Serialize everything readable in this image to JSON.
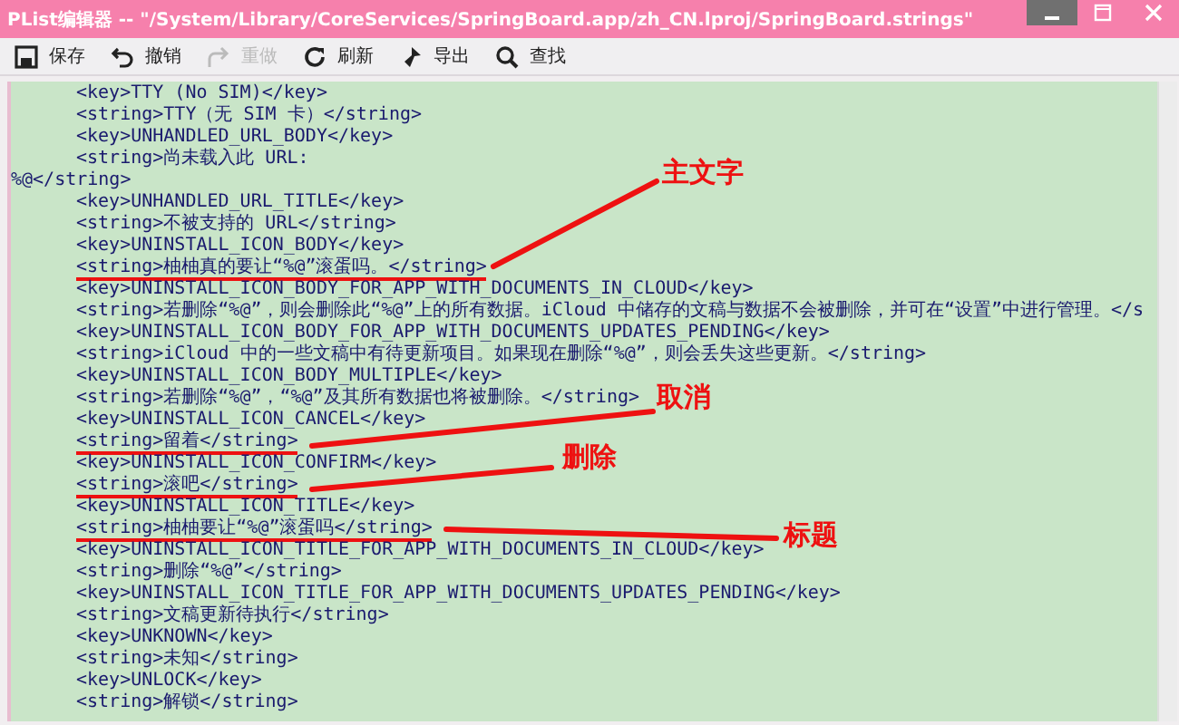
{
  "window": {
    "title": "PList编辑器 -- \"/System/Library/CoreServices/SpringBoard.app/zh_CN.lproj/SpringBoard.strings\""
  },
  "toolbar": [
    {
      "kind": "save",
      "label": "保存",
      "disabled": false
    },
    {
      "kind": "undo",
      "label": "撤销",
      "disabled": false
    },
    {
      "kind": "redo",
      "label": "重做",
      "disabled": true
    },
    {
      "kind": "refresh",
      "label": "刷新",
      "disabled": false
    },
    {
      "kind": "export",
      "label": "导出",
      "disabled": false
    },
    {
      "kind": "find",
      "label": "查找",
      "disabled": false
    }
  ],
  "editor": {
    "lines": [
      {
        "text": "<key>TTY (No SIM)</key>",
        "indent": true,
        "underlined": false
      },
      {
        "text": "<string>TTY（无 SIM 卡）</string>",
        "indent": true,
        "underlined": false
      },
      {
        "text": "<key>UNHANDLED_URL_BODY</key>",
        "indent": true,
        "underlined": false
      },
      {
        "text": "<string>尚未载入此 URL:",
        "indent": true,
        "underlined": false
      },
      {
        "text": "%@</string>",
        "indent": false,
        "underlined": false
      },
      {
        "text": "<key>UNHANDLED_URL_TITLE</key>",
        "indent": true,
        "underlined": false
      },
      {
        "text": "<string>不被支持的 URL</string>",
        "indent": true,
        "underlined": false
      },
      {
        "text": "<key>UNINSTALL_ICON_BODY</key>",
        "indent": true,
        "underlined": false
      },
      {
        "text": "<string>柚柚真的要让“%@”滚蛋吗。</string>",
        "indent": true,
        "underlined": true
      },
      {
        "text": "<key>UNINSTALL_ICON_BODY_FOR_APP_WITH_DOCUMENTS_IN_CLOUD</key>",
        "indent": true,
        "underlined": false
      },
      {
        "text": "<string>若删除“%@”，则会删除此“%@”上的所有数据。iCloud 中储存的文稿与数据不会被删除，并可在“设置”中进行管理。</s",
        "indent": true,
        "underlined": false
      },
      {
        "text": "<key>UNINSTALL_ICON_BODY_FOR_APP_WITH_DOCUMENTS_UPDATES_PENDING</key>",
        "indent": true,
        "underlined": false
      },
      {
        "text": "<string>iCloud 中的一些文稿中有待更新项目。如果现在删除“%@”，则会丢失这些更新。</string>",
        "indent": true,
        "underlined": false
      },
      {
        "text": "<key>UNINSTALL_ICON_BODY_MULTIPLE</key>",
        "indent": true,
        "underlined": false
      },
      {
        "text": "<string>若删除“%@”，“%@”及其所有数据也将被删除。</string>",
        "indent": true,
        "underlined": false
      },
      {
        "text": "<key>UNINSTALL_ICON_CANCEL</key>",
        "indent": true,
        "underlined": false
      },
      {
        "text": "<string>留着</string>",
        "indent": true,
        "underlined": true
      },
      {
        "text": "<key>UNINSTALL_ICON_CONFIRM</key>",
        "indent": true,
        "underlined": false
      },
      {
        "text": "<string>滚吧</string>",
        "indent": true,
        "underlined": true
      },
      {
        "text": "<key>UNINSTALL_ICON_TITLE</key>",
        "indent": true,
        "underlined": false
      },
      {
        "text": "<string>柚柚要让“%@”滚蛋吗</string>",
        "indent": true,
        "underlined": true
      },
      {
        "text": "<key>UNINSTALL_ICON_TITLE_FOR_APP_WITH_DOCUMENTS_IN_CLOUD</key>",
        "indent": true,
        "underlined": false
      },
      {
        "text": "<string>删除“%@”</string>",
        "indent": true,
        "underlined": false
      },
      {
        "text": "<key>UNINSTALL_ICON_TITLE_FOR_APP_WITH_DOCUMENTS_UPDATES_PENDING</key>",
        "indent": true,
        "underlined": false
      },
      {
        "text": "<string>文稿更新待执行</string>",
        "indent": true,
        "underlined": false
      },
      {
        "text": "<key>UNKNOWN</key>",
        "indent": true,
        "underlined": false
      },
      {
        "text": "<string>未知</string>",
        "indent": true,
        "underlined": false
      },
      {
        "text": "<key>UNLOCK</key>",
        "indent": true,
        "underlined": false
      },
      {
        "text": "<string>解锁</string>",
        "indent": true,
        "underlined": false
      }
    ]
  },
  "annotations": [
    {
      "label": "主文字"
    },
    {
      "label": "取消"
    },
    {
      "label": "删除"
    },
    {
      "label": "标题"
    }
  ]
}
